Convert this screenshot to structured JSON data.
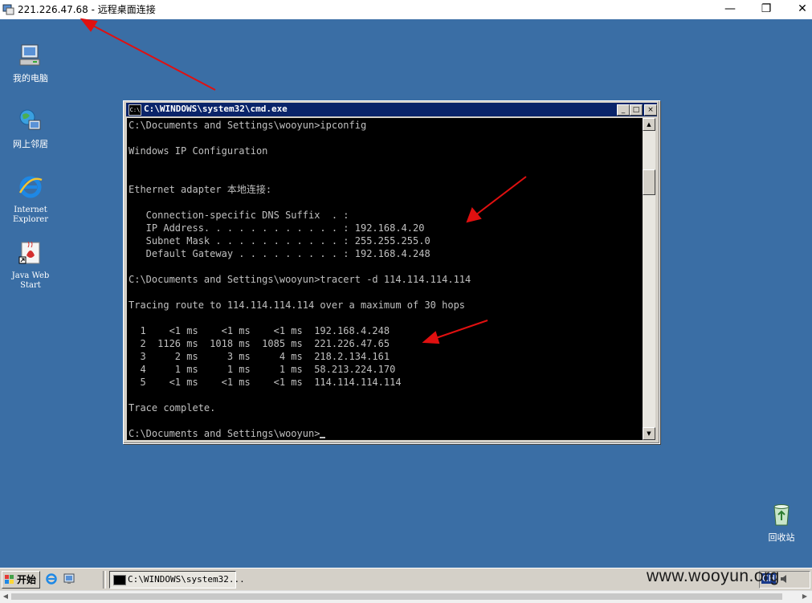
{
  "rdp": {
    "title": "221.226.47.68 - 远程桌面连接",
    "minimize": "—",
    "restore": "❐",
    "close": "✕"
  },
  "desktop_icons": [
    {
      "label": "我的电脑"
    },
    {
      "label": "网上邻居"
    },
    {
      "label": "Internet Explorer"
    },
    {
      "label": "Java Web Start"
    },
    {
      "label": "回收站"
    }
  ],
  "cmd": {
    "title": "C:\\WINDOWS\\system32\\cmd.exe",
    "lines": [
      "C:\\Documents and Settings\\wooyun>ipconfig",
      "",
      "Windows IP Configuration",
      "",
      "",
      "Ethernet adapter 本地连接:",
      "",
      "   Connection-specific DNS Suffix  . :",
      "   IP Address. . . . . . . . . . . . : 192.168.4.20",
      "   Subnet Mask . . . . . . . . . . . : 255.255.255.0",
      "   Default Gateway . . . . . . . . . : 192.168.4.248",
      "",
      "C:\\Documents and Settings\\wooyun>tracert -d 114.114.114.114",
      "",
      "Tracing route to 114.114.114.114 over a maximum of 30 hops",
      "",
      "  1    <1 ms    <1 ms    <1 ms  192.168.4.248",
      "  2  1126 ms  1018 ms  1085 ms  221.226.47.65",
      "  3     2 ms     3 ms     4 ms  218.2.134.161",
      "  4     1 ms     1 ms     1 ms  58.213.224.170",
      "  5    <1 ms    <1 ms    <1 ms  114.114.114.114",
      "",
      "Trace complete.",
      "",
      "C:\\Documents and Settings\\wooyun>"
    ]
  },
  "taskbar": {
    "start_label": "开始",
    "task_label": "C:\\WINDOWS\\system32...",
    "tray_text": "CH"
  },
  "watermark": "www.wooyun.org",
  "colors": {
    "desktop": "#3a6ea5",
    "titlebar_active": "#0a246a",
    "arrow": "#e01010"
  }
}
